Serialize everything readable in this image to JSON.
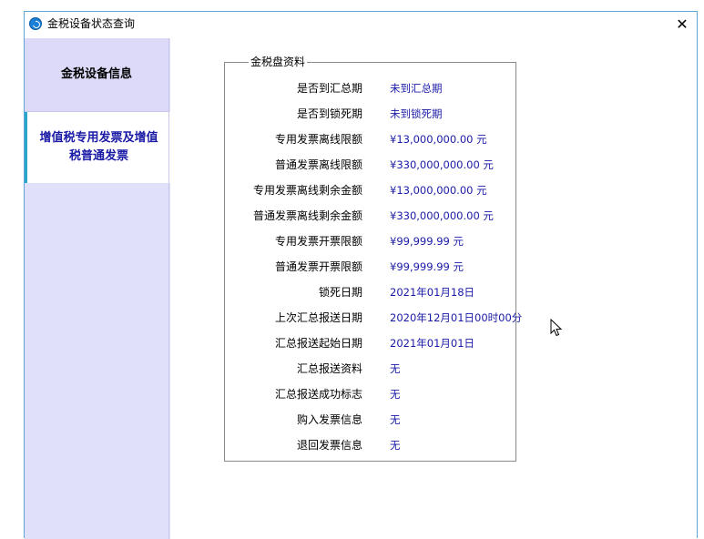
{
  "window": {
    "title": "金税设备状态查询",
    "close_glyph": "✕"
  },
  "sidebar": {
    "items": [
      {
        "label": "金税设备信息"
      },
      {
        "label": "增值税专用发票及增值税普通发票"
      }
    ]
  },
  "group": {
    "title": "金税盘资料",
    "rows": [
      {
        "label": "是否到汇总期",
        "value": "未到汇总期"
      },
      {
        "label": "是否到锁死期",
        "value": "未到锁死期"
      },
      {
        "label": "专用发票离线限额",
        "value": "¥13,000,000.00 元"
      },
      {
        "label": "普通发票离线限额",
        "value": "¥330,000,000.00 元"
      },
      {
        "label": "专用发票离线剩余金额",
        "value": "¥13,000,000.00 元"
      },
      {
        "label": "普通发票离线剩余金额",
        "value": "¥330,000,000.00 元"
      },
      {
        "label": "专用发票开票限额",
        "value": "¥99,999.99 元"
      },
      {
        "label": "普通发票开票限额",
        "value": "¥99,999.99 元"
      },
      {
        "label": "锁死日期",
        "value": "2021年01月18日"
      },
      {
        "label": "上次汇总报送日期",
        "value": "2020年12月01日00时00分"
      },
      {
        "label": "汇总报送起始日期",
        "value": "2021年01月01日"
      },
      {
        "label": "汇总报送资料",
        "value": "无"
      },
      {
        "label": "汇总报送成功标志",
        "value": "无"
      },
      {
        "label": "购入发票信息",
        "value": "无"
      },
      {
        "label": "退回发票信息",
        "value": "无"
      }
    ]
  },
  "colors": {
    "accent": "#1a1aa6",
    "sidebar_bg": "#e1e0fa",
    "window_border": "#5fa6d8",
    "active_marker": "#2aa6c8"
  }
}
